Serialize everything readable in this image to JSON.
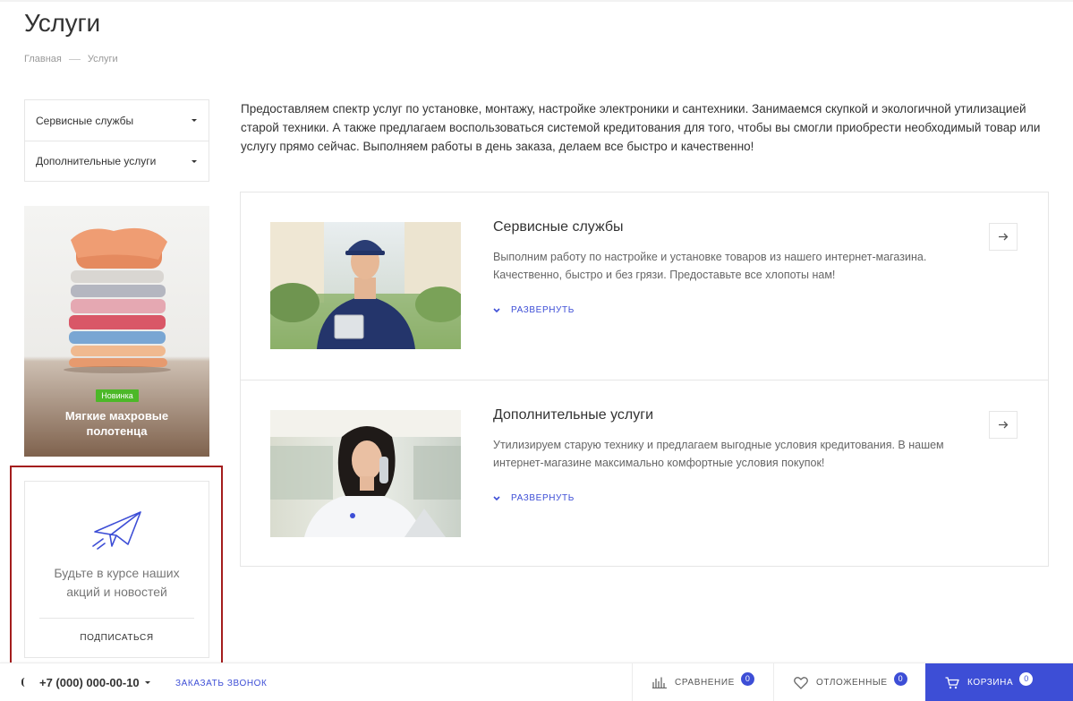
{
  "page": {
    "title": "Услуги"
  },
  "breadcrumb": {
    "home": "Главная",
    "current": "Услуги"
  },
  "sidebar": {
    "menu": [
      {
        "label": "Сервисные службы"
      },
      {
        "label": "Дополнительные услуги"
      }
    ],
    "banner": {
      "badge": "Новинка",
      "caption_line1": "Мягкие махровые",
      "caption_line2": "полотенца"
    },
    "subscribe": {
      "text_line1": "Будьте в курсе наших",
      "text_line2": "акций и новостей",
      "button": "ПОДПИСАТЬСЯ",
      "icon": "paper-plane-icon"
    }
  },
  "intro": {
    "text": "Предоставляем спектр услуг по установке, монтажу, настройке электроники и сантехники. Занимаемся скупкой и экологичной утилизацией старой техники. А также предлагаем воспользоваться системой кредитования для того, чтобы вы смогли приобрести необходимый товар или услугу прямо сейчас. Выполняем работы в день заказа, делаем все быстро и качественно!"
  },
  "services": [
    {
      "title": "Сервисные службы",
      "description": "Выполним работу по настройке и установке товаров из нашего интернет-магазина. Качественно, быстро и без грязи. Предоставьте все хлопоты нам!",
      "expand": "РАЗВЕРНУТЬ"
    },
    {
      "title": "Дополнительные услуги",
      "description": "Утилизируем старую технику и предлагаем выгодные условия кредитования. В нашем интернет-магазине максимально комфортные условия покупок!",
      "expand": "РАЗВЕРНУТЬ"
    }
  ],
  "bottom_bar": {
    "phone": "+7 (000) 000-00-10",
    "callback": "ЗАКАЗАТЬ ЗВОНОК",
    "compare": {
      "label": "СРАВНЕНИЕ",
      "count": "0"
    },
    "delayed": {
      "label": "ОТЛОЖЕННЫЕ",
      "count": "0"
    },
    "cart": {
      "label": "КОРЗИНА",
      "count": "0"
    }
  },
  "colors": {
    "accent": "#3d4ed6",
    "badge_green": "#4cb828",
    "highlight_frame": "#a41d1d"
  }
}
